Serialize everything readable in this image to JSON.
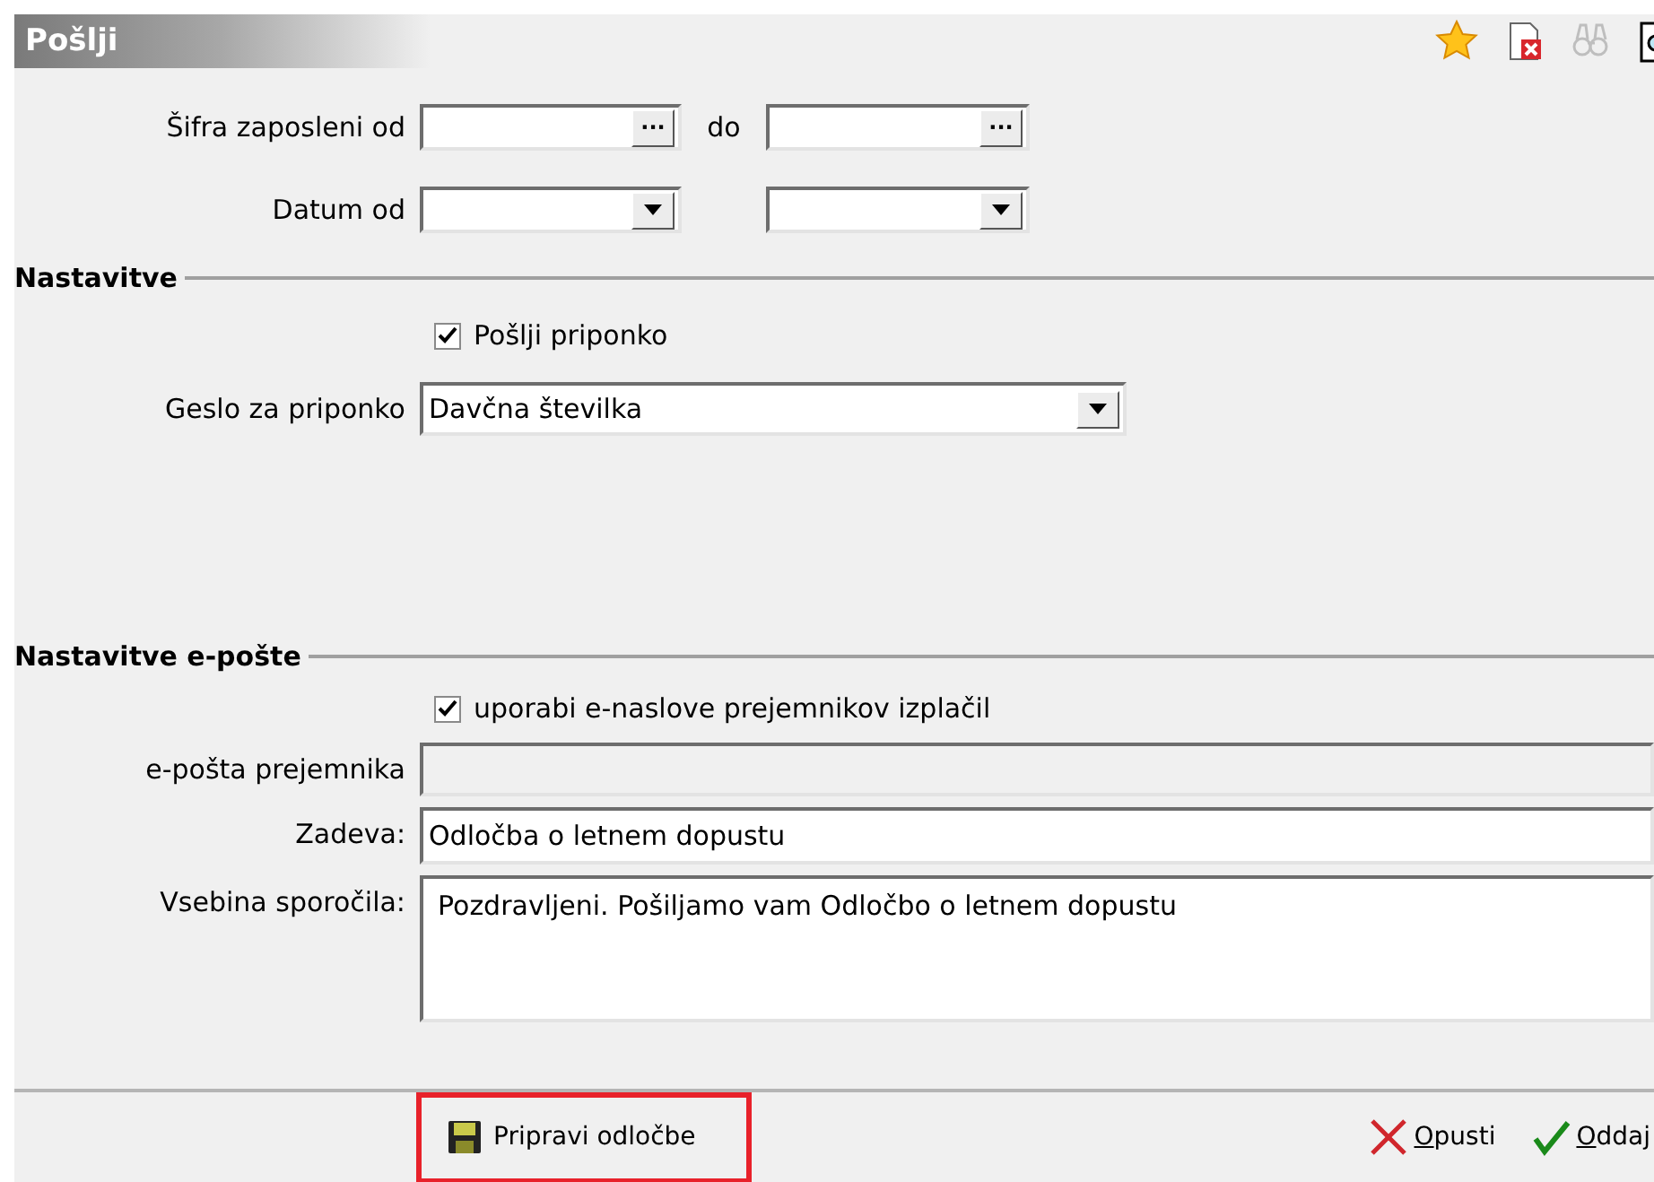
{
  "window": {
    "title": "Pošlji"
  },
  "toolbar": [
    {
      "kind": "star"
    },
    {
      "kind": "delete-doc"
    },
    {
      "kind": "binoculars",
      "disabled": true
    },
    {
      "kind": "preview"
    }
  ],
  "filters": [
    {
      "label": "Šifra zaposleni od",
      "kind": "lookup",
      "button": "···",
      "separator": "do"
    },
    {
      "label": "Datum od",
      "kind": "combo"
    }
  ],
  "settings": {
    "title": "Nastavitve",
    "send_attachment": {
      "label": "Pošlji priponko",
      "checked": true
    },
    "password": {
      "label": "Geslo za priponko",
      "value": "Davčna številka"
    }
  },
  "email": {
    "title": "Nastavitve e-pošte",
    "use_addresses": {
      "label": "uporabi e-naslove prejemnikov izplačil",
      "checked": true
    },
    "recipient": {
      "label": "e-pošta prejemnika",
      "disabled": true
    },
    "subject": {
      "label": "Zadeva:",
      "value": "Odločba o letnem dopustu"
    },
    "body": {
      "label": "Vsebina sporočila:",
      "value": "Pozdravljeni. Pošiljamo vam Odločbo o letnem dopustu"
    }
  },
  "footer": {
    "prepare": {
      "label": "Pripravi odločbe",
      "highlighted": true
    },
    "actions": [
      {
        "kind": "cancel",
        "label": "Opusti"
      },
      {
        "kind": "ok",
        "label": "Oddaj"
      }
    ]
  }
}
